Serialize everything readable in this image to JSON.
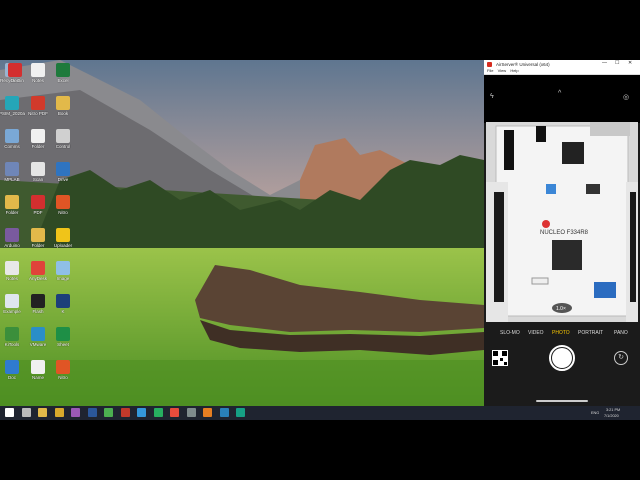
{
  "desktop": {
    "icons": [
      {
        "label": "Recycle Bin",
        "color": "#9ab4d0"
      },
      {
        "label": "PSIM_2020a",
        "color": "#25a6b8"
      },
      {
        "label": "Comms",
        "color": "#7aa8d6"
      },
      {
        "label": "MPLAB",
        "color": "#6f86b8"
      },
      {
        "label": "Folder",
        "color": "#e2b94a"
      },
      {
        "label": "Arduino",
        "color": "#7a5a9e"
      },
      {
        "label": "Notes",
        "color": "#e8e8e8"
      },
      {
        "label": "Example",
        "color": "#dfe6ee"
      },
      {
        "label": "KiTools",
        "color": "#3b8f3b"
      },
      {
        "label": "Doc",
        "color": "#2f7bd0"
      },
      {
        "label": "Notes",
        "color": "#f0f0f0"
      },
      {
        "label": "Nitro PDF",
        "color": "#d13a2b"
      },
      {
        "label": "Folder",
        "color": "#f0f0f0"
      },
      {
        "label": "Scan",
        "color": "#e5e5e5"
      },
      {
        "label": "PDF",
        "color": "#d32f2f"
      },
      {
        "label": "Folder",
        "color": "#e2b94a"
      },
      {
        "label": "AnyDesk",
        "color": "#e0433a"
      },
      {
        "label": "Flash",
        "color": "#222"
      },
      {
        "label": "VMware",
        "color": "#2a8ec8"
      },
      {
        "label": "Name",
        "color": "#f0f0f0"
      },
      {
        "label": "Excel",
        "color": "#1e7a3c"
      },
      {
        "label": "Book",
        "color": "#e2b94a"
      },
      {
        "label": "Control",
        "color": "#d0d0d0"
      },
      {
        "label": "Drive",
        "color": "#2f74c0"
      },
      {
        "label": "Nitro",
        "color": "#e05525"
      },
      {
        "label": "Uploader",
        "color": "#f0c419"
      },
      {
        "label": "Image",
        "color": "#8fbfe6"
      },
      {
        "label": "K",
        "color": "#1c3f7a"
      },
      {
        "label": "Sheet",
        "color": "#1e8f46"
      },
      {
        "label": "Nitro",
        "color": "#e05525"
      },
      {
        "label": "Doc",
        "color": "#d32f2f"
      }
    ]
  },
  "phone_window": {
    "title": "AirServer® Universal (x64)",
    "menu": [
      "File",
      "View",
      "Help"
    ],
    "controls": [
      "—",
      "☐",
      "✕"
    ],
    "camera": {
      "modes": [
        "SLO-MO",
        "VIDEO",
        "PHOTO",
        "PORTRAIT",
        "PANO"
      ],
      "active_mode": "PHOTO",
      "zoom": "1.0×",
      "board_label": "NUCLEO F334R8"
    }
  },
  "taskbar": {
    "time": "3:21 PM",
    "date": "7/1/2020",
    "lang": "ENG",
    "apps": [
      {
        "name": "start",
        "color": "#ffffff"
      },
      {
        "name": "search",
        "color": "#bbbbbb"
      },
      {
        "name": "explorer",
        "color": "#e2b94a"
      },
      {
        "name": "chrome",
        "color": "#d8a92c"
      },
      {
        "name": "app1",
        "color": "#9b59b6"
      },
      {
        "name": "word",
        "color": "#2b579a"
      },
      {
        "name": "app2",
        "color": "#4caf50"
      },
      {
        "name": "pdf",
        "color": "#c0392b"
      },
      {
        "name": "app3",
        "color": "#3498db"
      },
      {
        "name": "app4",
        "color": "#27ae60"
      },
      {
        "name": "app5",
        "color": "#e74c3c"
      },
      {
        "name": "app6",
        "color": "#7f8c8d"
      },
      {
        "name": "app7",
        "color": "#e67e22"
      },
      {
        "name": "app8",
        "color": "#2980b9"
      },
      {
        "name": "app9",
        "color": "#16a085"
      }
    ]
  }
}
